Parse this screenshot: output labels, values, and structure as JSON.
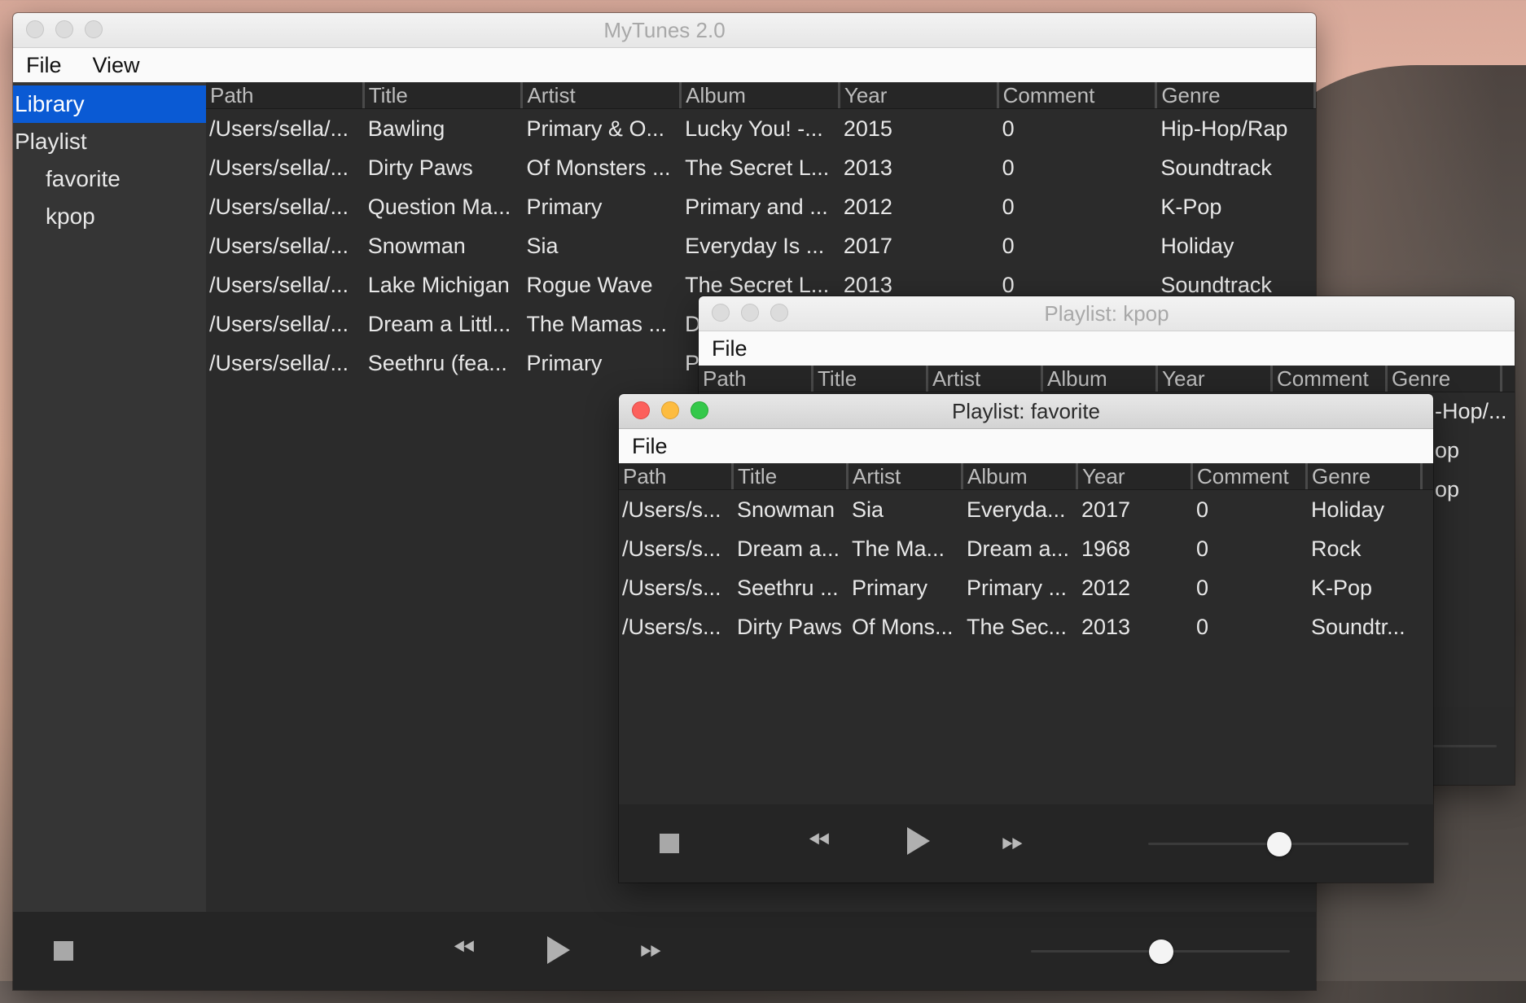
{
  "columns": [
    "Path",
    "Title",
    "Artist",
    "Album",
    "Year",
    "Comment",
    "Genre"
  ],
  "main": {
    "title": "MyTunes 2.0",
    "menu": [
      "File",
      "View"
    ],
    "sidebar": {
      "library": "Library",
      "playlist": "Playlist",
      "playlists": [
        "favorite",
        "kpop"
      ]
    },
    "rows": [
      [
        "/Users/sella/...",
        "Bawling",
        "Primary & O...",
        "Lucky You! -...",
        "2015",
        "0",
        "Hip-Hop/Rap"
      ],
      [
        "/Users/sella/...",
        "Dirty Paws",
        "Of Monsters ...",
        "The Secret L...",
        "2013",
        "0",
        "Soundtrack"
      ],
      [
        "/Users/sella/...",
        "Question Ma...",
        "Primary",
        "Primary and ...",
        "2012",
        "0",
        "K-Pop"
      ],
      [
        "/Users/sella/...",
        "Snowman",
        "Sia",
        "Everyday Is ...",
        "2017",
        "0",
        "Holiday"
      ],
      [
        "/Users/sella/...",
        "Lake Michigan",
        "Rogue Wave",
        "The Secret L...",
        "2013",
        "0",
        "Soundtrack"
      ],
      [
        "/Users/sella/...",
        "Dream a Littl...",
        "The Mamas ...",
        "D",
        "",
        "",
        ""
      ],
      [
        "/Users/sella/...",
        "Seethru (fea...",
        "Primary",
        "P",
        "",
        "",
        ""
      ]
    ],
    "volume": 0.5
  },
  "kpop": {
    "title": "Playlist: kpop",
    "menu": [
      "File"
    ],
    "visible_genre_fragments": [
      "-Hop/...",
      "op",
      "op"
    ]
  },
  "favorite": {
    "title": "Playlist: favorite",
    "menu": [
      "File"
    ],
    "rows": [
      [
        "/Users/s...",
        "Snowman",
        "Sia",
        "Everyda...",
        "2017",
        "0",
        "Holiday"
      ],
      [
        "/Users/s...",
        "Dream a...",
        "The Ma...",
        "Dream a...",
        "1968",
        "0",
        "Rock"
      ],
      [
        "/Users/s...",
        "Seethru ...",
        "Primary",
        "Primary ...",
        "2012",
        "0",
        "K-Pop"
      ],
      [
        "/Users/s...",
        "Dirty Paws",
        "Of Mons...",
        "The Sec...",
        "2013",
        "0",
        "Soundtr..."
      ]
    ],
    "volume": 0.5
  },
  "icons": {
    "stop": "stop-icon",
    "previous": "rewind-icon",
    "play": "play-icon",
    "next": "fast-forward-icon"
  }
}
